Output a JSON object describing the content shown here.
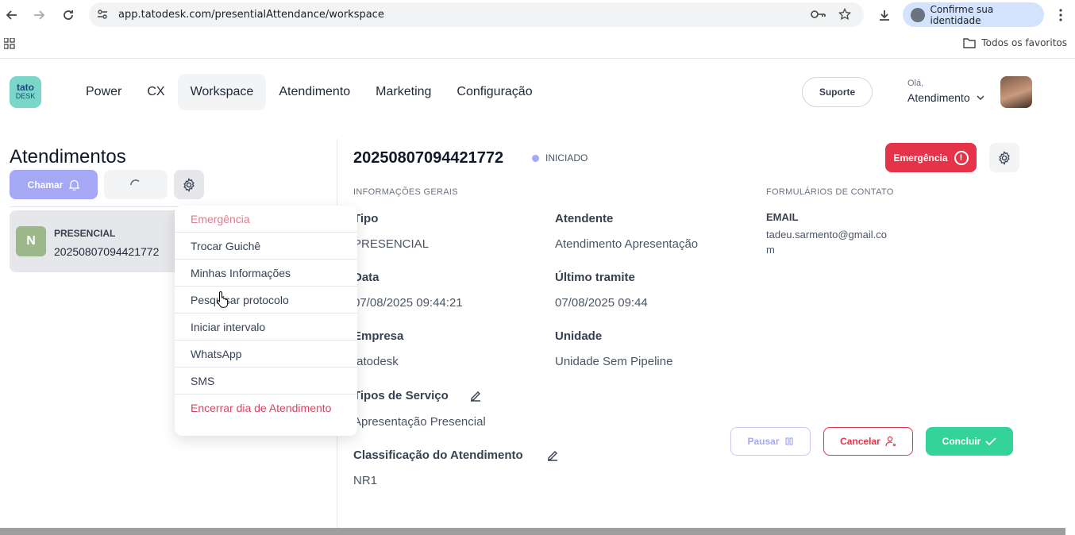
{
  "browser": {
    "url": "app.tatodesk.com/presentialAttendance/workspace",
    "identity": "Confirme sua identidade",
    "bookmarks_folder": "Todos os favoritos"
  },
  "header": {
    "logo_top": "tato",
    "logo_bottom": "DESK",
    "nav": [
      "Power",
      "CX",
      "Workspace",
      "Atendimento",
      "Marketing",
      "Configuração"
    ],
    "active_nav": "Workspace",
    "support": "Suporte",
    "greeting": "Olá,",
    "user": "Atendimento"
  },
  "sidebar": {
    "title": "Atendimentos",
    "call_button": "Chamar",
    "card": {
      "initial": "N",
      "type": "PRESENCIAL",
      "number": "20250807094421772"
    }
  },
  "menu": {
    "items": [
      "Emergência",
      "Trocar Guichê",
      "Minhas Informações",
      "Pesquisar protocolo",
      "Iniciar intervalo",
      "WhatsApp",
      "SMS",
      "Encerrar dia de Atendimento"
    ]
  },
  "detail": {
    "protocol": "20250807094421772",
    "status": "INICIADO",
    "emergency_button": "Emergência",
    "general_title": "INFORMAÇÕES GERAIS",
    "contact_title": "FORMULÁRIOS DE CONTATO",
    "fields": {
      "tipo_label": "Tipo",
      "tipo_value": "PRESENCIAL",
      "atendente_label": "Atendente",
      "atendente_value": "Atendimento Apresentação",
      "data_label": "Data",
      "data_value": "07/08/2025 09:44:21",
      "ultimo_label": "Último tramite",
      "ultimo_value": "07/08/2025 09:44",
      "empresa_label": "Empresa",
      "empresa_value": "tatodesk",
      "unidade_label": "Unidade",
      "unidade_value": "Unidade Sem Pipeline",
      "servico_label": "Tipos de Serviço",
      "servico_value": "Apresentação Presencial",
      "classificacao_label": "Classificação do Atendimento",
      "classificacao_value": "NR1"
    },
    "email_label": "EMAIL",
    "email_value": "tadeu.sarmento@gmail.com"
  },
  "actions": {
    "pause": "Pausar",
    "cancel": "Cancelar",
    "complete": "Concluir"
  },
  "colors": {
    "primary": "#a5a8f5",
    "danger": "#e5344a",
    "success": "#34d399",
    "logo": "#7ad6c8"
  }
}
